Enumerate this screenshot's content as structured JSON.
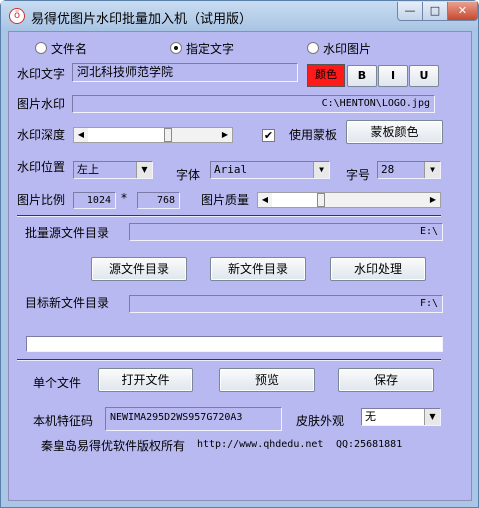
{
  "window": {
    "title": "易得优图片水印批量加入机（试用版）",
    "minimize_glyph": "—",
    "maximize_glyph": "□",
    "close_glyph": "✕",
    "app_icon_glyph": "ö"
  },
  "mode_options": [
    {
      "label": "文件名",
      "selected": false
    },
    {
      "label": "指定文字",
      "selected": true
    },
    {
      "label": "水印图片",
      "selected": false
    }
  ],
  "watermark_text": {
    "label": "水印文字",
    "value": "河北科技师范学院"
  },
  "style_buttons": {
    "color": "颜色",
    "bold": "B",
    "italic": "I",
    "underline": "U"
  },
  "image_watermark": {
    "label": "图片水印",
    "value": "C:\\HENTON\\LOGO.jpg"
  },
  "depth": {
    "label": "水印深度",
    "level_fraction": 0.64
  },
  "mask": {
    "checkbox_label": "使用蒙板",
    "checked": true,
    "checkmark": "✔",
    "color_button": "蒙板颜色"
  },
  "position": {
    "label": "水印位置",
    "value": "左上"
  },
  "font": {
    "label": "字体",
    "value": "Arial"
  },
  "font_size": {
    "label": "字号",
    "value": "28"
  },
  "ratio": {
    "label": "图片比例",
    "width": "1024",
    "separator": "*",
    "height": "768"
  },
  "quality": {
    "label": "图片质量",
    "level_fraction": 0.29
  },
  "source_dir": {
    "label": "批量源文件目录",
    "value": "E:\\"
  },
  "actions": {
    "source_dir": "源文件目录",
    "new_dir": "新文件目录",
    "process": "水印处理"
  },
  "target_dir": {
    "label": "目标新文件目录",
    "value": "F:\\"
  },
  "single_file": {
    "label": "单个文件",
    "open": "打开文件",
    "preview": "预览",
    "save": "保存"
  },
  "machine_code": {
    "label": "本机特征码",
    "value": "NEWIMA295D2WS957G720A3"
  },
  "skin": {
    "label": "皮肤外观",
    "value": "无"
  },
  "footer": {
    "copyright": "秦皇岛易得优软件版权所有",
    "url": "http://www.qhdedu.net",
    "qq": "QQ:25681881"
  },
  "scroll_glyphs": {
    "left": "◀",
    "right": "▶",
    "down": "▼"
  }
}
